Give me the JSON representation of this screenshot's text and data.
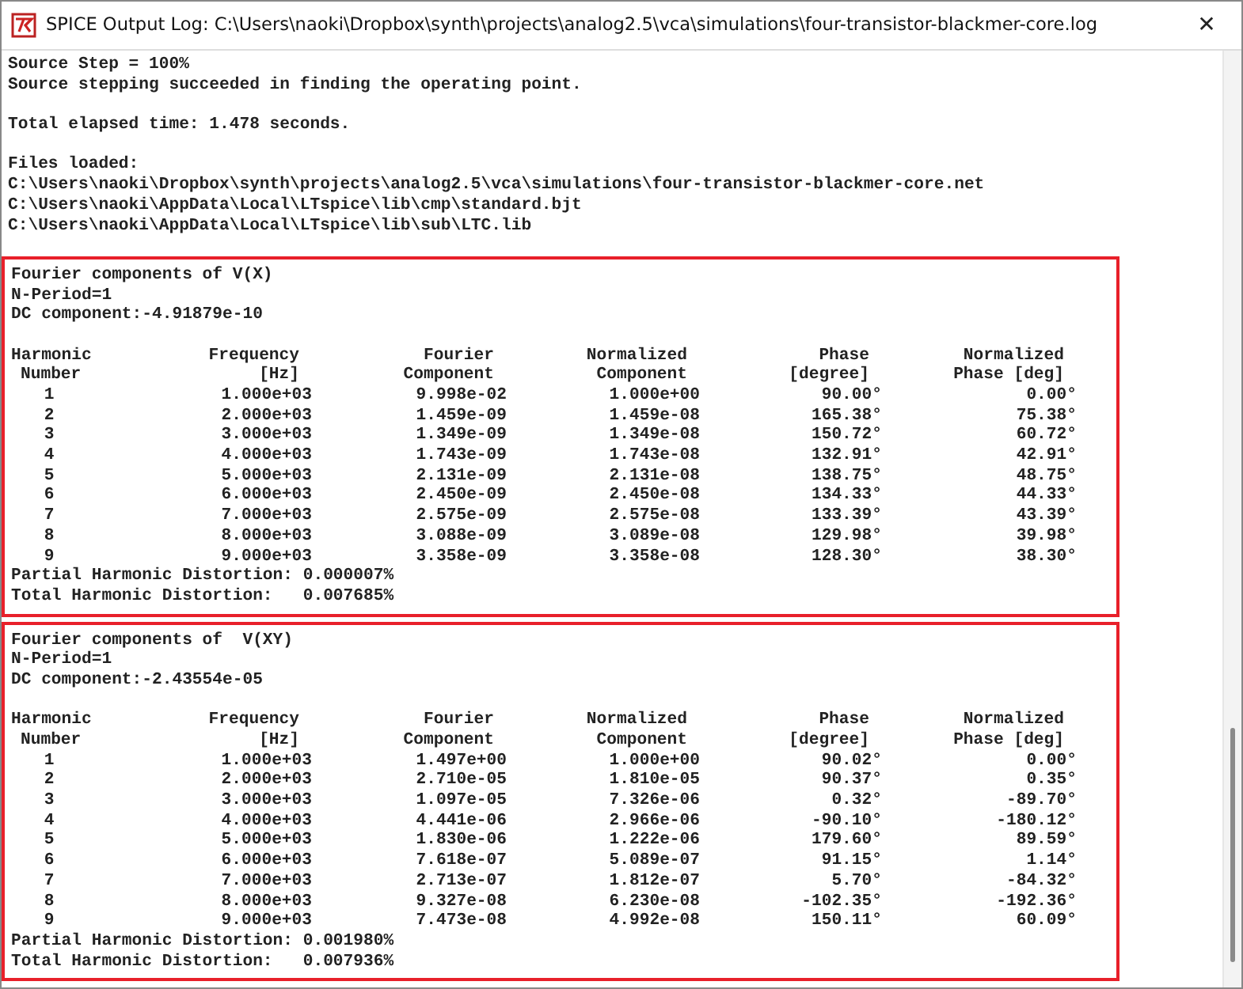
{
  "window": {
    "title": "SPICE Output Log: C:\\Users\\naoki\\Dropbox\\synth\\projects\\analog2.5\\vca\\simulations\\four-transistor-blackmer-core.log",
    "close": "✕"
  },
  "log_paragraphs": [
    [
      "Source Step = 100%",
      "Source stepping succeeded in finding the operating point."
    ],
    [
      "Total elapsed time: 1.478 seconds."
    ],
    [
      "Files loaded:",
      "C:\\Users\\naoki\\Dropbox\\synth\\projects\\analog2.5\\vca\\simulations\\four-transistor-blackmer-core.net",
      "C:\\Users\\naoki\\AppData\\Local\\LTspice\\lib\\cmp\\standard.bjt",
      "C:\\Users\\naoki\\AppData\\Local\\LTspice\\lib\\sub\\LTC.lib"
    ]
  ],
  "fourier_blocks": [
    {
      "highlighted": true,
      "title": "Fourier components of V(X)",
      "n_period": "N-Period=1",
      "dc_component": "DC component:-4.91879e-10",
      "header_rows": [
        [
          "Harmonic",
          "Frequency",
          "Fourier",
          "Normalized",
          "Phase",
          "Normalized"
        ],
        [
          "Number",
          "[Hz]",
          "Component",
          "Component",
          "[degree]",
          "Phase [deg]"
        ]
      ],
      "rows": [
        [
          "1",
          "1.000e+03",
          "9.998e-02",
          "1.000e+00",
          "90.00°",
          "0.00°"
        ],
        [
          "2",
          "2.000e+03",
          "1.459e-09",
          "1.459e-08",
          "165.38°",
          "75.38°"
        ],
        [
          "3",
          "3.000e+03",
          "1.349e-09",
          "1.349e-08",
          "150.72°",
          "60.72°"
        ],
        [
          "4",
          "4.000e+03",
          "1.743e-09",
          "1.743e-08",
          "132.91°",
          "42.91°"
        ],
        [
          "5",
          "5.000e+03",
          "2.131e-09",
          "2.131e-08",
          "138.75°",
          "48.75°"
        ],
        [
          "6",
          "6.000e+03",
          "2.450e-09",
          "2.450e-08",
          "134.33°",
          "44.33°"
        ],
        [
          "7",
          "7.000e+03",
          "2.575e-09",
          "2.575e-08",
          "133.39°",
          "43.39°"
        ],
        [
          "8",
          "8.000e+03",
          "3.088e-09",
          "3.089e-08",
          "129.98°",
          "39.98°"
        ],
        [
          "9",
          "9.000e+03",
          "3.358e-09",
          "3.358e-08",
          "128.30°",
          "38.30°"
        ]
      ],
      "partial_hd": "Partial Harmonic Distortion: 0.000007%",
      "total_hd": "Total Harmonic Distortion:   0.007685%"
    },
    {
      "highlighted": true,
      "title": "Fourier components of  V(XY)",
      "n_period": "N-Period=1",
      "dc_component": "DC component:-2.43554e-05",
      "header_rows": [
        [
          "Harmonic",
          "Frequency",
          "Fourier",
          "Normalized",
          "Phase",
          "Normalized"
        ],
        [
          "Number",
          "[Hz]",
          "Component",
          "Component",
          "[degree]",
          "Phase [deg]"
        ]
      ],
      "rows": [
        [
          "1",
          "1.000e+03",
          "1.497e+00",
          "1.000e+00",
          "90.02°",
          "0.00°"
        ],
        [
          "2",
          "2.000e+03",
          "2.710e-05",
          "1.810e-05",
          "90.37°",
          "0.35°"
        ],
        [
          "3",
          "3.000e+03",
          "1.097e-05",
          "7.326e-06",
          "0.32°",
          "-89.70°"
        ],
        [
          "4",
          "4.000e+03",
          "4.441e-06",
          "2.966e-06",
          "-90.10°",
          "-180.12°"
        ],
        [
          "5",
          "5.000e+03",
          "1.830e-06",
          "1.222e-06",
          "179.60°",
          "89.59°"
        ],
        [
          "6",
          "6.000e+03",
          "7.618e-07",
          "5.089e-07",
          "91.15°",
          "1.14°"
        ],
        [
          "7",
          "7.000e+03",
          "2.713e-07",
          "1.812e-07",
          "5.70°",
          "-84.32°"
        ],
        [
          "8",
          "8.000e+03",
          "9.327e-08",
          "6.230e-08",
          "-102.35°",
          "-192.36°"
        ],
        [
          "9",
          "9.000e+03",
          "7.473e-08",
          "4.992e-08",
          "150.11°",
          "60.09°"
        ]
      ],
      "partial_hd": "Partial Harmonic Distortion: 0.001980%",
      "total_hd": "Total Harmonic Distortion:   0.007936%"
    }
  ]
}
